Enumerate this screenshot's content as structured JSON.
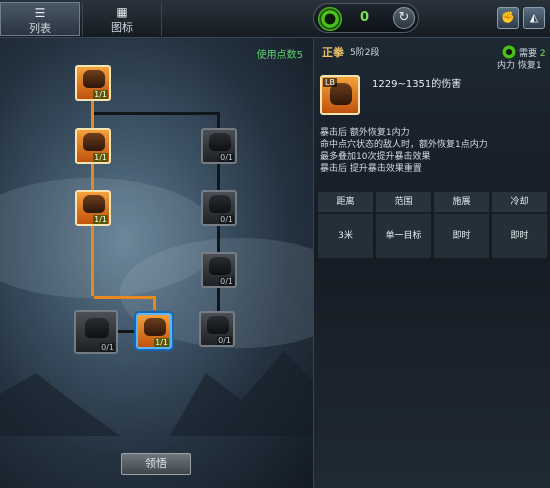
{
  "tabs": [
    {
      "label": "列表",
      "icon": "list-icon"
    },
    {
      "label": "图标",
      "icon": "grid-icon"
    }
  ],
  "points": {
    "value": "0",
    "icon": "swirl-icon",
    "reset_icon": "reset-icon"
  },
  "corner_buttons": [
    {
      "icon": "thumbs-up-icon",
      "glyph": "👍"
    },
    {
      "icon": "book-icon",
      "glyph": "▲▲"
    }
  ],
  "tree": {
    "used_points": "使用点数5",
    "learn_button": "领悟",
    "nodes": [
      {
        "name": "skill-node-1",
        "state": "active",
        "rank": "1/1"
      },
      {
        "name": "skill-node-2",
        "state": "active",
        "rank": "1/1"
      },
      {
        "name": "skill-node-3",
        "state": "active",
        "rank": "1/1"
      },
      {
        "name": "skill-node-4",
        "state": "locked",
        "rank": "0/1"
      },
      {
        "name": "skill-node-5",
        "state": "active-selected",
        "rank": "1/1"
      },
      {
        "name": "skill-node-6",
        "state": "locked",
        "rank": "0/1"
      },
      {
        "name": "skill-node-7",
        "state": "locked",
        "rank": "0/1"
      },
      {
        "name": "skill-node-8",
        "state": "locked",
        "rank": "0/1"
      },
      {
        "name": "skill-node-9",
        "state": "locked",
        "rank": "0/1"
      }
    ]
  },
  "detail": {
    "skill_name": "正拳",
    "skill_level": "5阶2段",
    "need_label": "需要",
    "need_value": "2",
    "need_sub": "内力 恢复1",
    "icon_tag": "LB",
    "damage": "1229~1351的伤害",
    "description": [
      "暴击后 额外恢复1内力",
      "命中点穴状态的敌人时，额外恢复1点内力",
      "最多叠加10次提升暴击效果",
      "暴击后 提升暴击效果重置"
    ],
    "stats": [
      {
        "label": "距离",
        "value": "3米"
      },
      {
        "label": "范围",
        "value": "单一目标"
      },
      {
        "label": "施展",
        "value": "即时"
      },
      {
        "label": "冷却",
        "value": "即时"
      }
    ]
  },
  "colors": {
    "accent_orange": "#e6891f",
    "points_green": "#7ee04e",
    "used_points_green": "#5fd06f",
    "skill_name_gold": "#e8c064",
    "selected_blue": "#56b6ff"
  }
}
